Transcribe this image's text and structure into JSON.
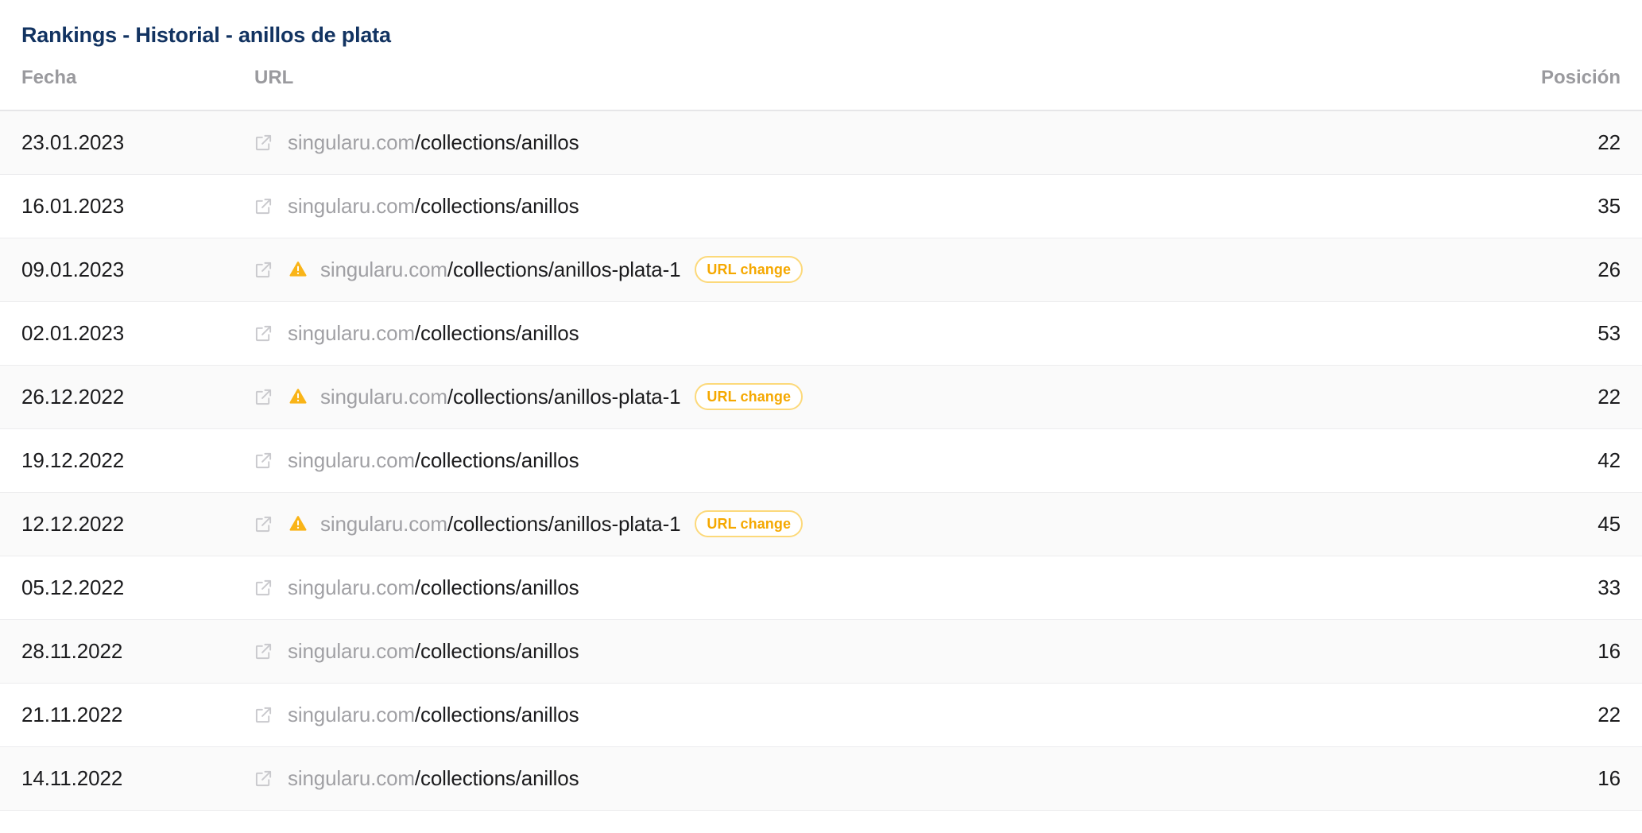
{
  "panel": {
    "title": "Rankings - Historial - anillos de plata"
  },
  "table": {
    "columns": {
      "date": "Fecha",
      "url": "URL",
      "position": "Posición"
    },
    "badge_label": "URL change",
    "icons": {
      "external_link": "external-link-icon",
      "warning": "warning-triangle-icon"
    },
    "colors": {
      "title": "#123361",
      "header_text": "#9a9a9e",
      "domain_text": "#a0a0a4",
      "path_text": "#1b1b1d",
      "badge_border": "#fcd97a",
      "badge_text": "#f5a800",
      "warning_fill": "#f9b417",
      "row_alt_background": "#fafafa",
      "row_background": "#ffffff",
      "row_divider": "#ececee"
    },
    "rows": [
      {
        "date": "23.01.2023",
        "domain": "singularu.com",
        "path": "/collections/anillos",
        "url_changed": false,
        "position": "22"
      },
      {
        "date": "16.01.2023",
        "domain": "singularu.com",
        "path": "/collections/anillos",
        "url_changed": false,
        "position": "35"
      },
      {
        "date": "09.01.2023",
        "domain": "singularu.com",
        "path": "/collections/anillos-plata-1",
        "url_changed": true,
        "position": "26"
      },
      {
        "date": "02.01.2023",
        "domain": "singularu.com",
        "path": "/collections/anillos",
        "url_changed": false,
        "position": "53"
      },
      {
        "date": "26.12.2022",
        "domain": "singularu.com",
        "path": "/collections/anillos-plata-1",
        "url_changed": true,
        "position": "22"
      },
      {
        "date": "19.12.2022",
        "domain": "singularu.com",
        "path": "/collections/anillos",
        "url_changed": false,
        "position": "42"
      },
      {
        "date": "12.12.2022",
        "domain": "singularu.com",
        "path": "/collections/anillos-plata-1",
        "url_changed": true,
        "position": "45"
      },
      {
        "date": "05.12.2022",
        "domain": "singularu.com",
        "path": "/collections/anillos",
        "url_changed": false,
        "position": "33"
      },
      {
        "date": "28.11.2022",
        "domain": "singularu.com",
        "path": "/collections/anillos",
        "url_changed": false,
        "position": "16"
      },
      {
        "date": "21.11.2022",
        "domain": "singularu.com",
        "path": "/collections/anillos",
        "url_changed": false,
        "position": "22"
      },
      {
        "date": "14.11.2022",
        "domain": "singularu.com",
        "path": "/collections/anillos",
        "url_changed": false,
        "position": "16"
      }
    ]
  }
}
